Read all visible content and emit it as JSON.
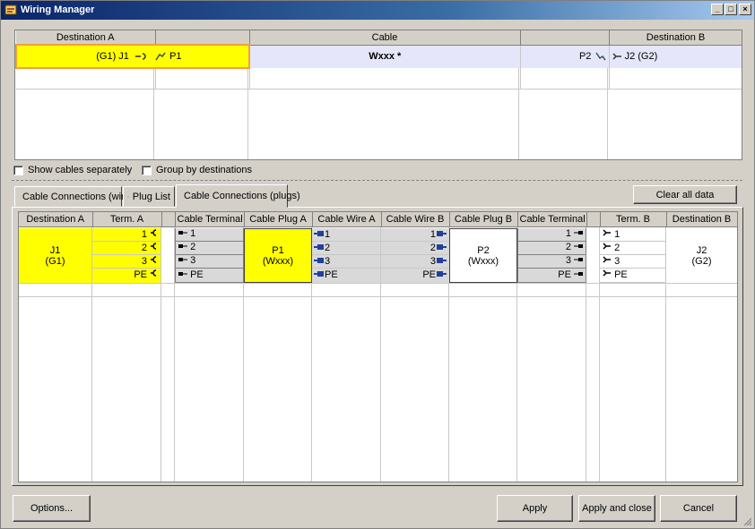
{
  "window": {
    "title": "Wiring Manager"
  },
  "top_grid": {
    "headers": [
      "Destination A",
      "",
      "Cable",
      "",
      "Destination B"
    ],
    "row": {
      "dest_a": "(G1) J1",
      "plug_a": "P1",
      "cable": "Wxxx *",
      "plug_b": "P2",
      "dest_b": "J2 (G2)"
    }
  },
  "options": {
    "show_separately": "Show cables separately",
    "group_by": "Group by destinations"
  },
  "tabs": [
    {
      "label": "Cable Connections (wires)"
    },
    {
      "label": "Plug List"
    },
    {
      "label": "Cable Connections (plugs)"
    }
  ],
  "clear_button": "Clear all data",
  "bottom_grid": {
    "headers": [
      "Destination A",
      "Term. A",
      "",
      "Cable Terminal",
      "Cable Plug A",
      "Cable Wire A",
      "Cable Wire B",
      "Cable Plug B",
      "Cable Terminal",
      "",
      "Term. B",
      "Destination B"
    ],
    "dest_a": {
      "line1": "J1",
      "line2": "(G1)"
    },
    "plug_a": {
      "line1": "P1",
      "line2": "(Wxxx)"
    },
    "plug_b": {
      "line1": "P2",
      "line2": "(Wxxx)"
    },
    "dest_b": {
      "line1": "J2",
      "line2": "(G2)"
    },
    "pins": [
      "1",
      "2",
      "3",
      "PE"
    ]
  },
  "buttons": {
    "options": "Options...",
    "apply": "Apply",
    "apply_close": "Apply and close",
    "cancel": "Cancel"
  },
  "colors": {
    "highlight": "#ffff00",
    "selected_row": "#e6e6fa",
    "grey_cell": "#d9d9d9"
  }
}
